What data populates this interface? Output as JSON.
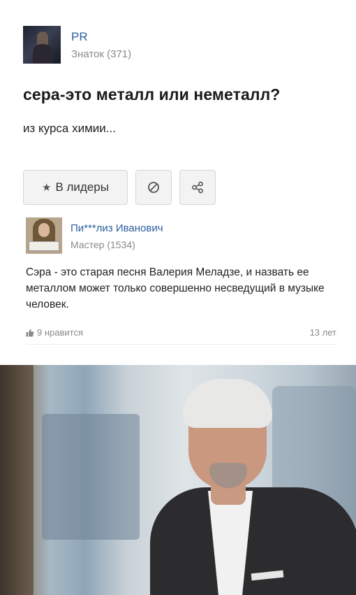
{
  "question": {
    "author_name": "PR",
    "author_rank": "Знаток (371)",
    "title": "сера-это металл или неметалл?",
    "body": "из курса химии..."
  },
  "actions": {
    "leaders_label": "В лидеры",
    "star_icon": "star-icon",
    "block_icon": "block-icon",
    "share_icon": "share-icon"
  },
  "answer": {
    "author_name": "Пи***лиз Иванович",
    "author_rank": "Мастер (1534)",
    "text": "Сэра - это старая песня Валерия Меладзе, и назвать ее металлом может только совершенно несведущий в музыке человек.",
    "likes": "9 нравится",
    "age": "13 лет"
  },
  "colors": {
    "link": "#2d5fa0",
    "muted": "#8a8a8a",
    "button_bg": "#f3f3f3"
  }
}
